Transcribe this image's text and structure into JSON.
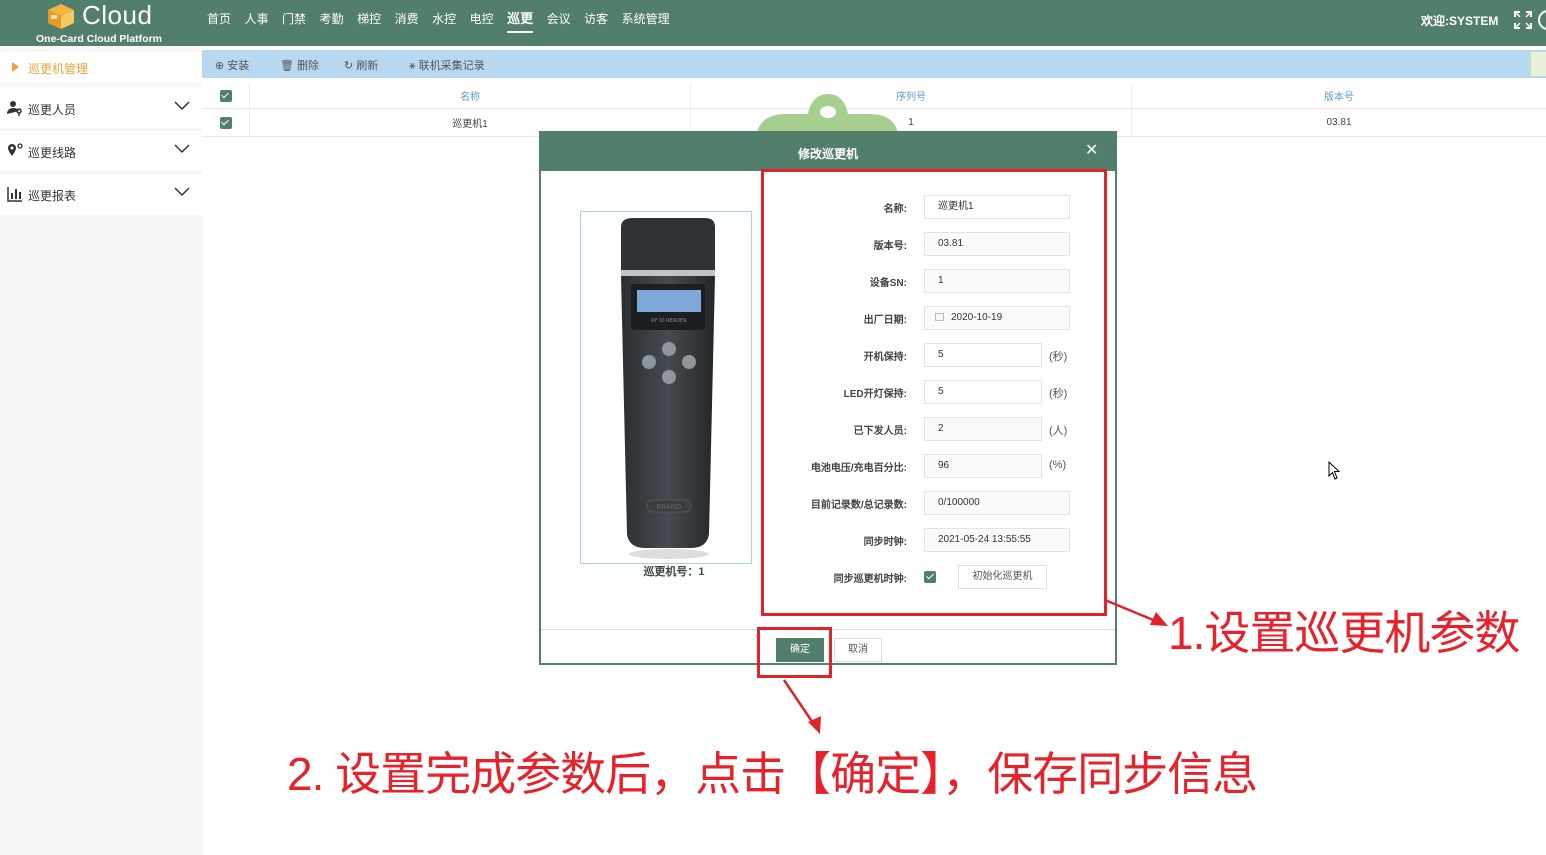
{
  "header": {
    "logo_title": "Cloud",
    "logo_subtitle": "One-Card Cloud Platform",
    "nav": [
      "首页",
      "人事",
      "门禁",
      "考勤",
      "梯控",
      "消费",
      "水控",
      "电控",
      "巡更",
      "会议",
      "访客",
      "系统管理"
    ],
    "active_nav": "巡更",
    "welcome": "欢迎:SYSTEM"
  },
  "sidebar": {
    "active_label": "巡更机管理",
    "items": [
      {
        "label": "巡更人员",
        "icon": "user-key-icon"
      },
      {
        "label": "巡更线路",
        "icon": "route-pin-icon"
      },
      {
        "label": "巡更报表",
        "icon": "bar-chart-icon"
      }
    ]
  },
  "toolbar": {
    "install": "安装",
    "delete": "删除",
    "refresh": "刷新",
    "records": "联机采集记录"
  },
  "grid": {
    "columns": [
      "名称",
      "序列号",
      "版本号"
    ],
    "rows": [
      {
        "name": "巡更机1",
        "serial": "1",
        "version": "03.81"
      }
    ]
  },
  "modal": {
    "title": "修改巡更机",
    "device_caption": "巡更机号：1",
    "device_screen_text": "RF ID READER",
    "device_brand": "BRAND",
    "fields": {
      "name": {
        "label": "名称:",
        "value": "巡更机1"
      },
      "version": {
        "label": "版本号:",
        "value": "03.81"
      },
      "sn": {
        "label": "设备SN:",
        "value": "1"
      },
      "date": {
        "label": "出厂日期:",
        "value": "2020-10-19"
      },
      "boot_keep": {
        "label": "开机保持:",
        "value": "5",
        "unit": "(秒)"
      },
      "led_keep": {
        "label": "LED开灯保持:",
        "value": "5",
        "unit": "(秒)"
      },
      "issued": {
        "label": "已下发人员:",
        "value": "2",
        "unit": "(人)"
      },
      "battery": {
        "label": "电池电压/充电百分比:",
        "value": "96",
        "unit": "(%)"
      },
      "records": {
        "label": "目前记录数/总记录数:",
        "value": "0/100000"
      },
      "sync_clock": {
        "label": "同步时钟:",
        "value": "2021-05-24 13:55:55"
      },
      "sync_device_clock": {
        "label": "同步巡更机时钟:",
        "checked": true
      }
    },
    "init_button": "初始化巡更机",
    "ok": "确定",
    "cancel": "取消"
  },
  "annotations": {
    "note1": "1.设置巡更机参数",
    "note2": "2. 设置完成参数后，点击【确定】，保存同步信息"
  },
  "colors": {
    "theme": "#527e6c",
    "accent": "#e8a33c",
    "annotation_red": "#e8222a",
    "toolbar_bg": "#b8d8f2"
  }
}
